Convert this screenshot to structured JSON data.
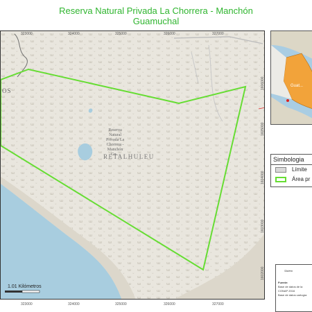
{
  "title_line1": "Reserva Natural Privada La Chorrera - Manchón",
  "title_line2": "Guamuchal",
  "map": {
    "town_label": "OS",
    "department_label": "RETALHULEU",
    "reserve_label_lines": [
      "Reserva",
      "Natural",
      "Privada La",
      "Chorrera -",
      "Manchón",
      "Gu..."
    ],
    "scale_label": "1.01 Kilómetros",
    "x_ticks_top": [
      "323000",
      "324000",
      "325000",
      "326000",
      "327000"
    ],
    "x_ticks_bottom": [
      "323000",
      "324000",
      "325000",
      "326000",
      "327000"
    ],
    "y_ticks_right": [
      "1606000",
      "1605000",
      "1604000",
      "1603000",
      "1602000"
    ],
    "boundary_color": "#66dd33",
    "sea_color": "#a8cddf",
    "land_color": "#e9e6de"
  },
  "inset": {
    "label": "Guat..."
  },
  "legend": {
    "title": "Simbologia",
    "items": [
      {
        "label": "Límite",
        "fill": "#d9d9d9",
        "stroke": "#888888"
      },
      {
        "label": "Área pr",
        "fill": "#ffffff",
        "stroke": "#66dd33"
      }
    ]
  },
  "source": {
    "heading": "Sistem",
    "fuente": "Fuente:",
    "line1": "Base de datos de la",
    "line2": "CONAP 2016",
    "line3": "Base de datos cartogra"
  }
}
